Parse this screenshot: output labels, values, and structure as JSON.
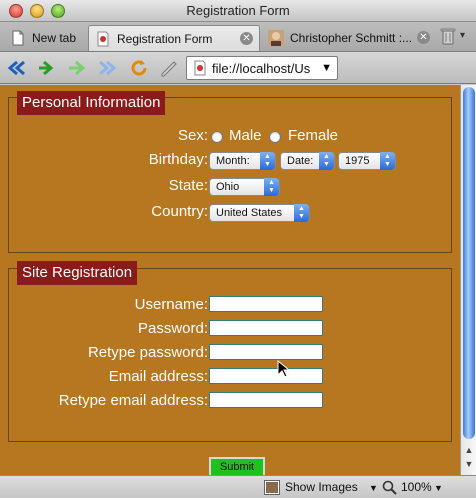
{
  "window": {
    "title": "Registration Form"
  },
  "tabs": [
    {
      "label": "New tab"
    },
    {
      "label": "Registration Form"
    },
    {
      "label": "Christopher Schmitt :..."
    }
  ],
  "toolbar": {
    "url": "file://localhost/Us",
    "icons": [
      "back-icon",
      "forward-icon",
      "fast-forward-icon",
      "reload-icon",
      "edit-icon"
    ]
  },
  "personal": {
    "legend": "Personal Information",
    "sex_label": "Sex:",
    "male": "Male",
    "female": "Female",
    "birthday_label": "Birthday:",
    "month": "Month:",
    "date": "Date:",
    "year": "1975",
    "state_label": "State:",
    "state": "Ohio",
    "country_label": "Country:",
    "country": "United States"
  },
  "site": {
    "legend": "Site Registration",
    "username_label": "Username:",
    "password_label": "Password:",
    "retype_password_label": "Retype password:",
    "email_label": "Email address:",
    "retype_email_label": "Retype email address:",
    "submit": "Submit"
  },
  "status": {
    "show_images": "Show Images",
    "zoom": "100%"
  },
  "colors": {
    "page_background": "#b77721",
    "legend_background": "#8b1a1a",
    "submit_background": "#20c020"
  }
}
